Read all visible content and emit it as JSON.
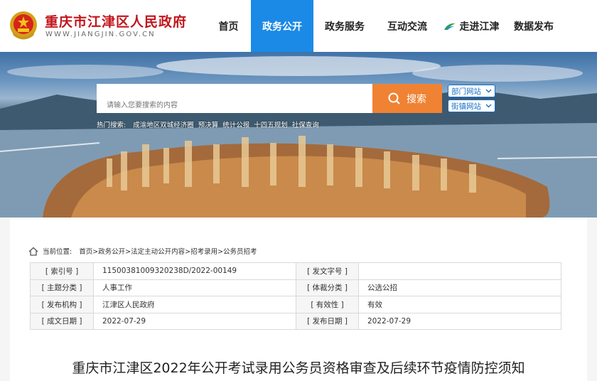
{
  "header": {
    "site_title": "重庆市江津区人民政府",
    "site_domain": "WWW.JIANGJIN.GOV.CN",
    "brand_color": "#c2151b",
    "accent_color": "#1b8ae6"
  },
  "nav": [
    {
      "label": "首页",
      "active": false
    },
    {
      "label": "政务公开",
      "active": true
    },
    {
      "label": "政务服务",
      "active": false
    },
    {
      "label": "互动交流",
      "active": false
    },
    {
      "label": "走进江津",
      "active": false,
      "icon": "leaf-logo-icon"
    },
    {
      "label": "数据发布",
      "active": false
    }
  ],
  "search": {
    "placeholder": "请输入您要搜索的内容",
    "button_label": "搜索",
    "button_color": "#f08233",
    "dept_site": "部门网站",
    "town_site": "街镇网站"
  },
  "hot": {
    "label": "热门搜索:",
    "items": [
      "成渝地区双城经济圈",
      "预决算",
      "统计公报",
      "十四五规划",
      "社保查询"
    ]
  },
  "breadcrumb": {
    "label": "当前位置:",
    "path": "首页>政务公开>法定主动公开内容>招考录用>公务员招考"
  },
  "meta": {
    "rows": [
      {
        "k1": "[ 索引号 ]",
        "v1": "11500381009320238D/2022-00149",
        "k2": "[ 发文字号 ]",
        "v2": ""
      },
      {
        "k1": "[ 主题分类 ]",
        "v1": "人事工作",
        "k2": "[ 体裁分类 ]",
        "v2": "公选公招"
      },
      {
        "k1": "[ 发布机构 ]",
        "v1": "江津区人民政府",
        "k2": "[ 有效性 ]",
        "v2": "有效"
      },
      {
        "k1": "[ 成文日期 ]",
        "v1": "2022-07-29",
        "k2": "[ 发布日期 ]",
        "v2": "2022-07-29"
      }
    ]
  },
  "article": {
    "title": "重庆市江津区2022年公开考试录用公务员资格审查及后续环节疫情防控须知"
  }
}
